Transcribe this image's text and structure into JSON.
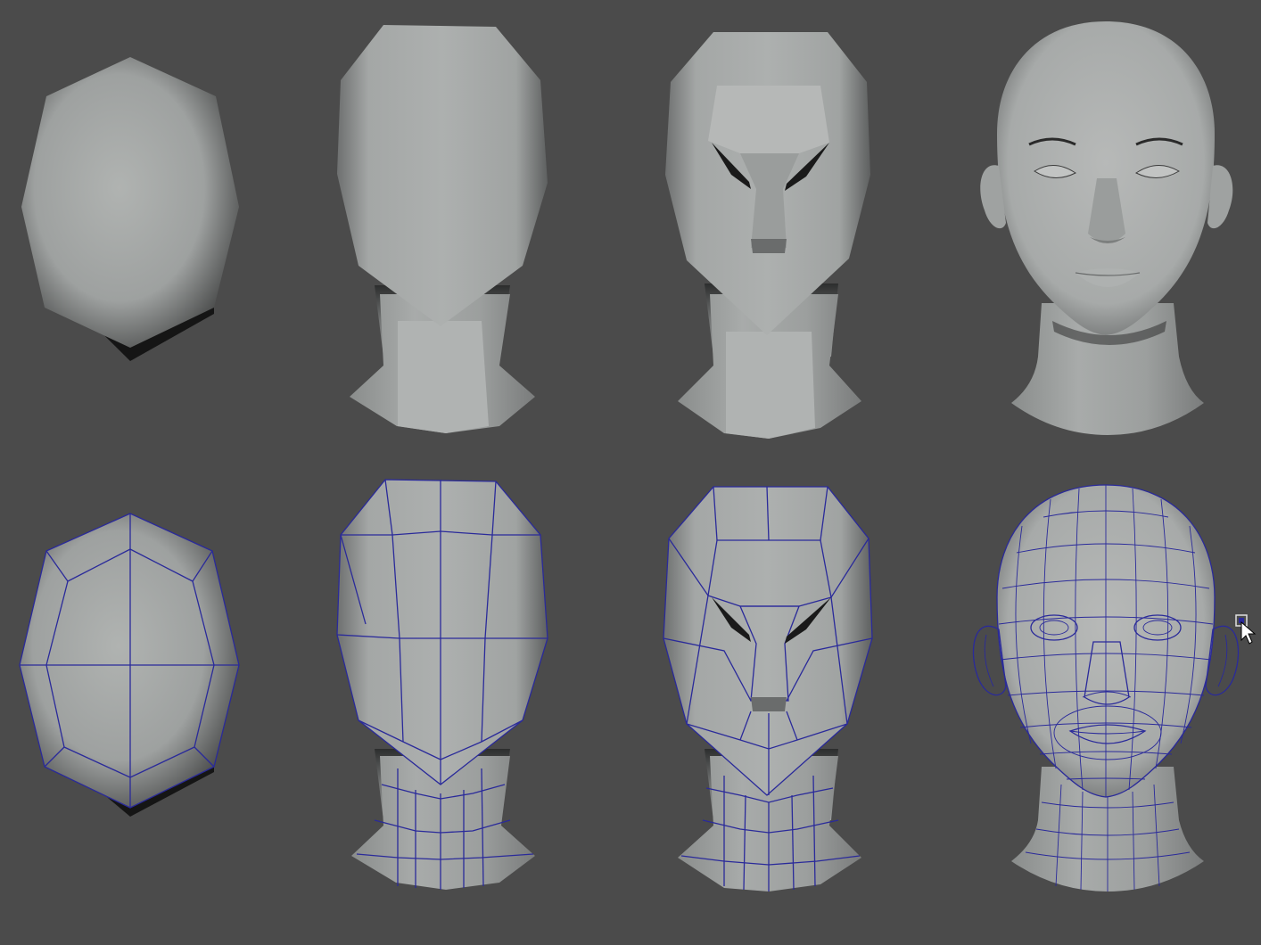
{
  "viewport": {
    "background": "#4b4b4b",
    "mesh_color": "#2a2a9a",
    "model_color": "#a3a6a5"
  },
  "rows": [
    {
      "shading": "smooth",
      "stages": [
        "base-sphere",
        "blocked-head-with-neck",
        "facial-planes",
        "final-sculpt"
      ]
    },
    {
      "shading": "wireframe-on-shaded",
      "stages": [
        "base-sphere",
        "blocked-head-with-neck",
        "facial-planes",
        "final-topology"
      ]
    }
  ],
  "cursor": {
    "icon": "mouse-pointer-icon",
    "gizmo": "selection-handle-icon"
  }
}
